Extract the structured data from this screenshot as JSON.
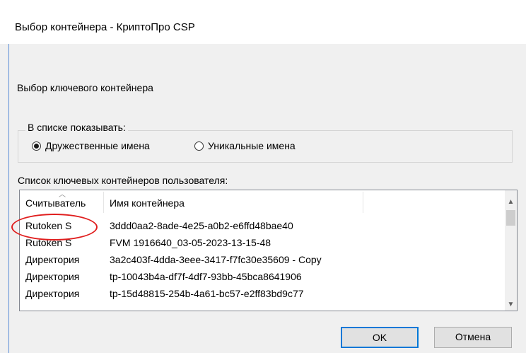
{
  "window": {
    "title": "Выбор контейнера - КриптоПро CSP"
  },
  "heading": "Выбор ключевого контейнера",
  "show_group": {
    "legend": "В списке показывать:",
    "options": [
      {
        "label": "Дружественные имена",
        "selected": true
      },
      {
        "label": "Уникальные имена",
        "selected": false
      }
    ]
  },
  "list": {
    "label": "Список ключевых контейнеров пользователя:",
    "columns": [
      "Считыватель",
      "Имя контейнера"
    ],
    "sort_indicator": "^",
    "rows": [
      {
        "reader": "Rutoken S",
        "name": "3ddd0aa2-8ade-4e25-a0b2-e6ffd48bae40"
      },
      {
        "reader": "Rutoken S",
        "name": "FVM 1916640_03-05-2023-13-15-48"
      },
      {
        "reader": "Директория",
        "name": "3a2c403f-4dda-3eee-3417-f7fc30e35609 - Copy"
      },
      {
        "reader": "Директория",
        "name": "tp-10043b4a-df7f-4df7-93bb-45bca8641906"
      },
      {
        "reader": "Директория",
        "name": "tp-15d48815-254b-4a61-bc57-e2ff83bd9c77"
      }
    ]
  },
  "annotation": {
    "color": "#e01e1e",
    "target": "Rutoken S"
  },
  "buttons": {
    "ok": "OK",
    "cancel": "Отмена"
  },
  "colors": {
    "accent": "#0078d7",
    "dialog_bg": "#f0f0f0"
  }
}
